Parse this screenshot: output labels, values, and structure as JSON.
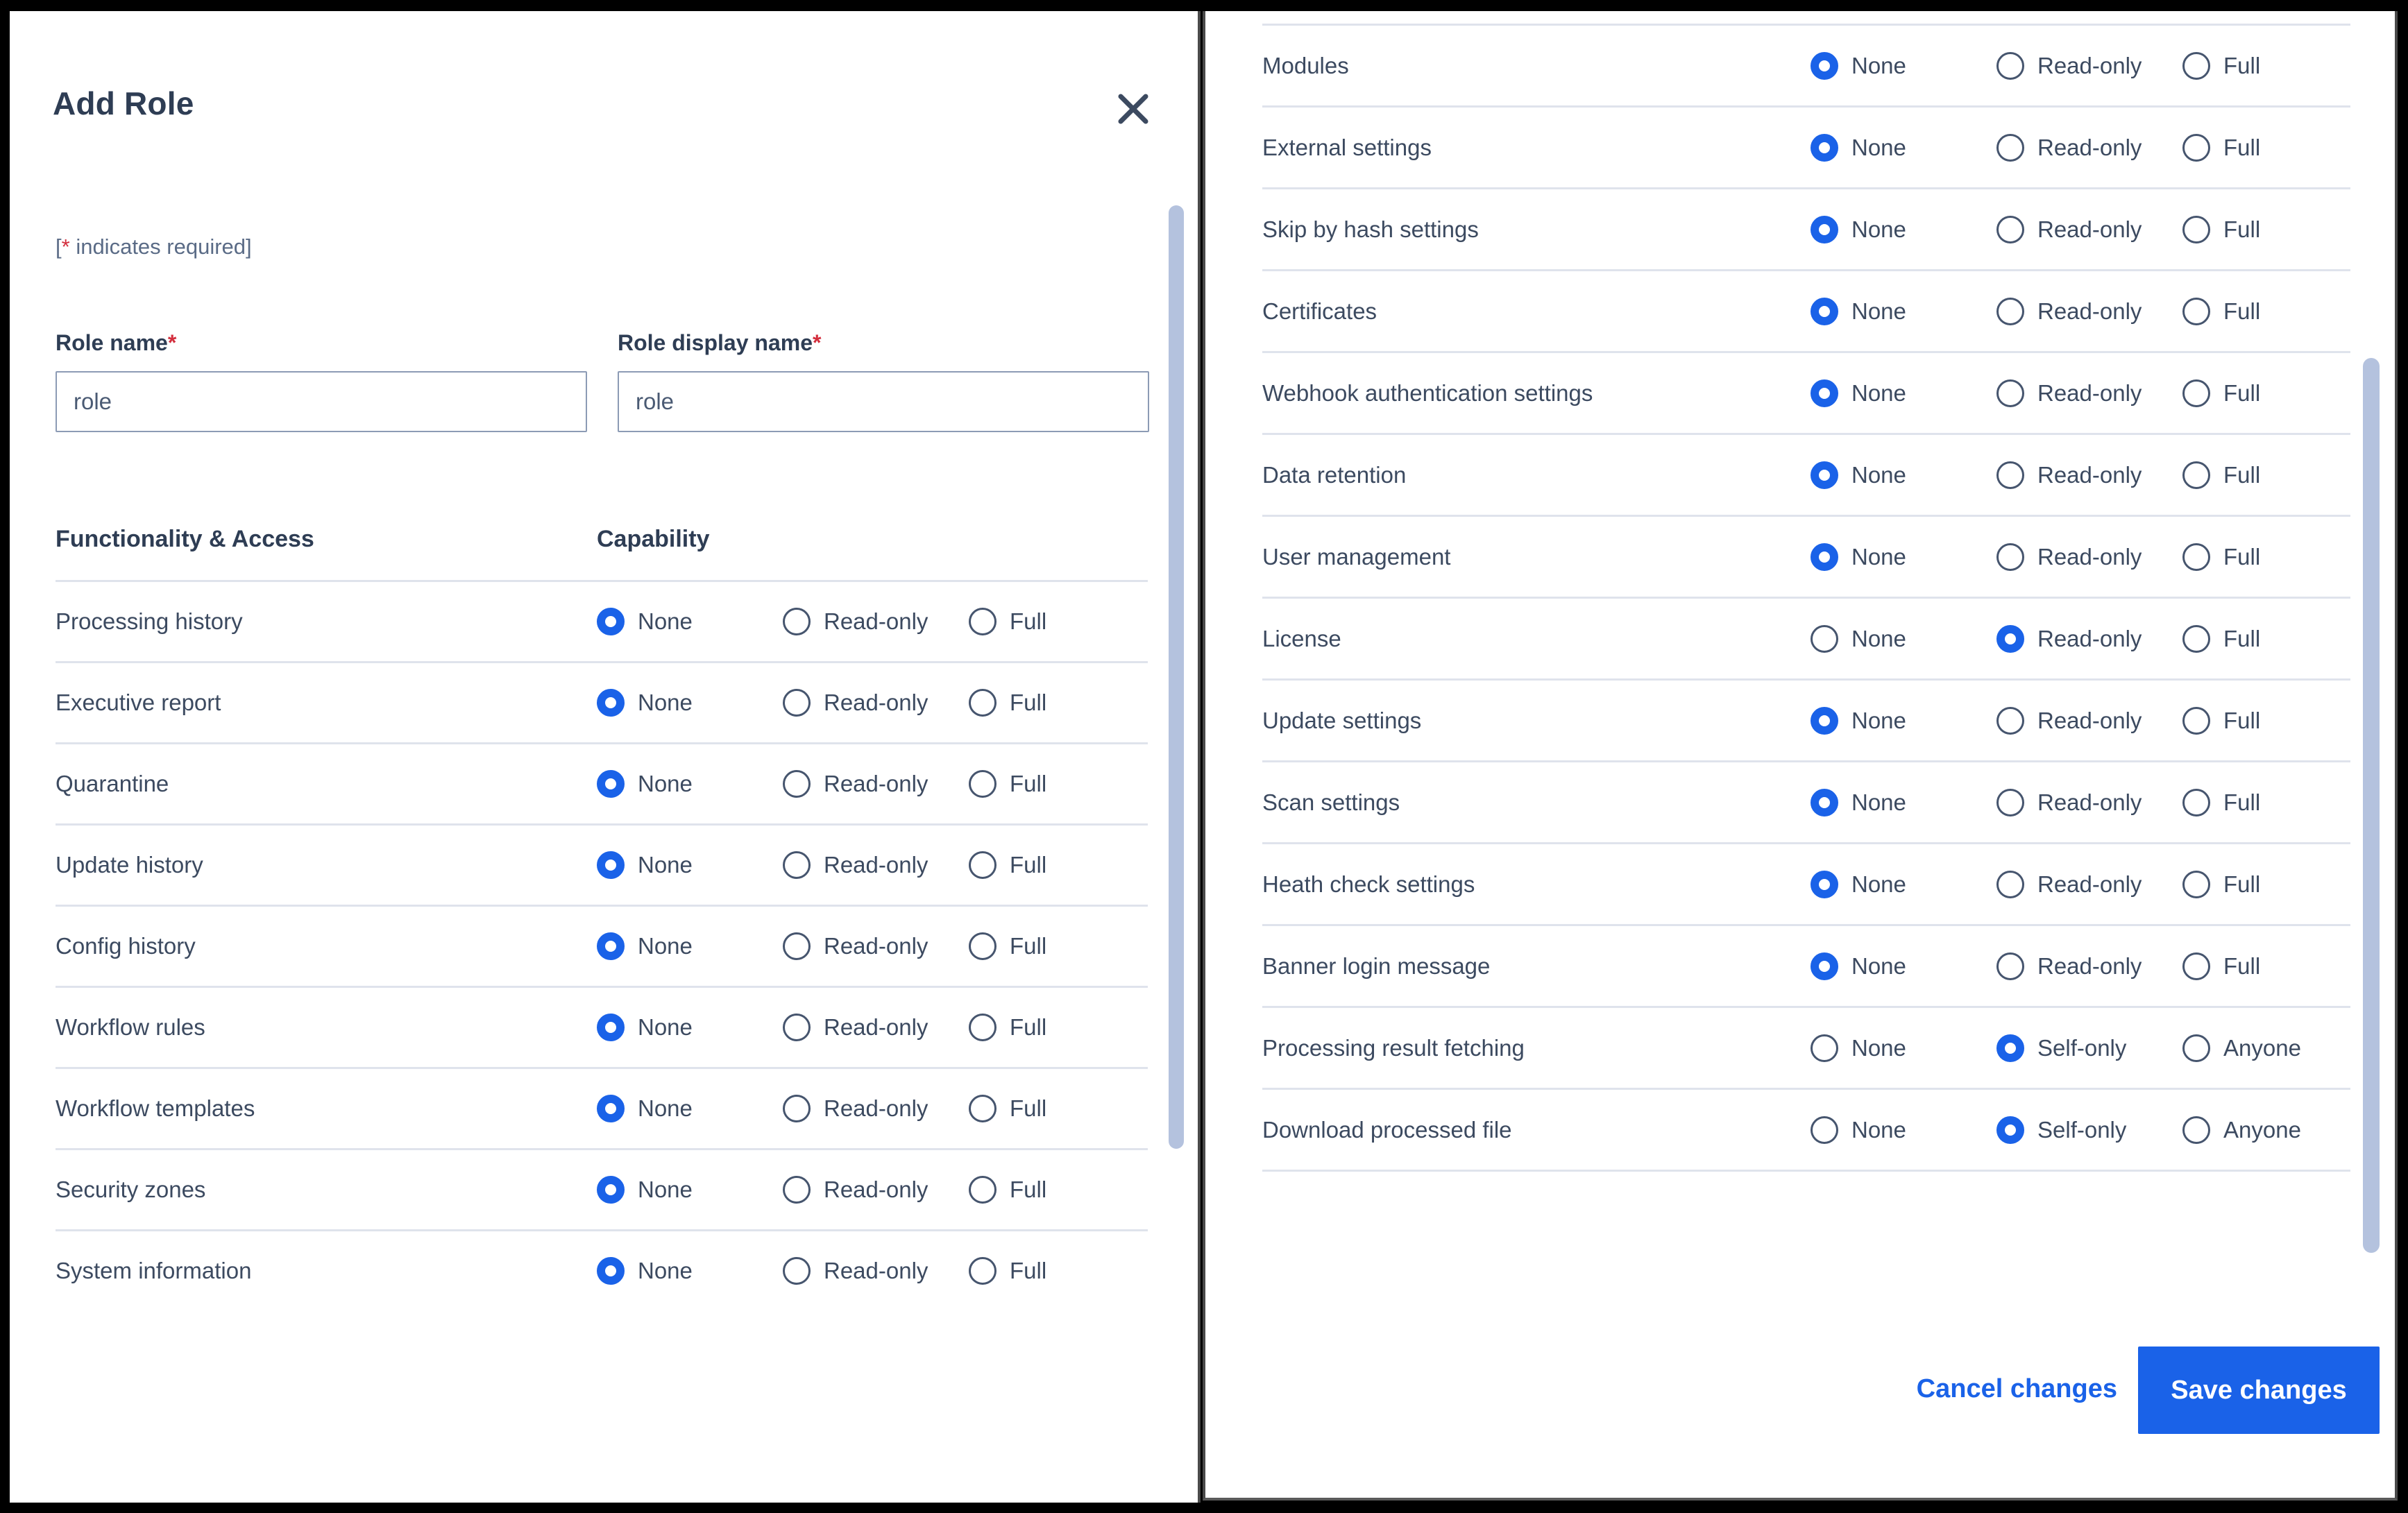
{
  "dialog": {
    "title": "Add Role",
    "close_icon": "close-icon",
    "required_note_prefix": "[",
    "required_note_star": "*",
    "required_note_text": " indicates required]",
    "accent_color": "#1a62e8",
    "required_star_color": "#d32e3d",
    "text_color": "#3c4a60",
    "heading_color": "#2e3d54"
  },
  "fields": {
    "role_name": {
      "label": "Role name",
      "required_mark": "*",
      "value": "role",
      "placeholder": "role"
    },
    "role_display_name": {
      "label": "Role display name",
      "required_mark": "*",
      "value": "role",
      "placeholder": "role"
    }
  },
  "table_headers": {
    "functionality": "Functionality & Access",
    "capability": "Capability"
  },
  "option_sets": {
    "access": [
      "None",
      "Read-only",
      "Full"
    ],
    "visibility": [
      "None",
      "Self-only",
      "Anyone"
    ]
  },
  "left_rows": [
    {
      "label": "Processing history",
      "options": [
        "None",
        "Read-only",
        "Full"
      ],
      "selected": 0
    },
    {
      "label": "Executive report",
      "options": [
        "None",
        "Read-only",
        "Full"
      ],
      "selected": 0
    },
    {
      "label": "Quarantine",
      "options": [
        "None",
        "Read-only",
        "Full"
      ],
      "selected": 0
    },
    {
      "label": "Update history",
      "options": [
        "None",
        "Read-only",
        "Full"
      ],
      "selected": 0
    },
    {
      "label": "Config history",
      "options": [
        "None",
        "Read-only",
        "Full"
      ],
      "selected": 0
    },
    {
      "label": "Workflow rules",
      "options": [
        "None",
        "Read-only",
        "Full"
      ],
      "selected": 0
    },
    {
      "label": "Workflow templates",
      "options": [
        "None",
        "Read-only",
        "Full"
      ],
      "selected": 0
    },
    {
      "label": "Security zones",
      "options": [
        "None",
        "Read-only",
        "Full"
      ],
      "selected": 0
    },
    {
      "label": "System information",
      "options": [
        "None",
        "Read-only",
        "Full"
      ],
      "selected": 0
    }
  ],
  "right_rows": [
    {
      "label": "Modules",
      "options": [
        "None",
        "Read-only",
        "Full"
      ],
      "selected": 0
    },
    {
      "label": "External settings",
      "options": [
        "None",
        "Read-only",
        "Full"
      ],
      "selected": 0
    },
    {
      "label": "Skip by hash settings",
      "options": [
        "None",
        "Read-only",
        "Full"
      ],
      "selected": 0
    },
    {
      "label": "Certificates",
      "options": [
        "None",
        "Read-only",
        "Full"
      ],
      "selected": 0
    },
    {
      "label": "Webhook authentication settings",
      "options": [
        "None",
        "Read-only",
        "Full"
      ],
      "selected": 0
    },
    {
      "label": "Data retention",
      "options": [
        "None",
        "Read-only",
        "Full"
      ],
      "selected": 0
    },
    {
      "label": "User management",
      "options": [
        "None",
        "Read-only",
        "Full"
      ],
      "selected": 0
    },
    {
      "label": "License",
      "options": [
        "None",
        "Read-only",
        "Full"
      ],
      "selected": 1
    },
    {
      "label": "Update settings",
      "options": [
        "None",
        "Read-only",
        "Full"
      ],
      "selected": 0
    },
    {
      "label": "Scan settings",
      "options": [
        "None",
        "Read-only",
        "Full"
      ],
      "selected": 0
    },
    {
      "label": "Heath check settings",
      "options": [
        "None",
        "Read-only",
        "Full"
      ],
      "selected": 0
    },
    {
      "label": "Banner login message",
      "options": [
        "None",
        "Read-only",
        "Full"
      ],
      "selected": 0
    },
    {
      "label": "Processing result fetching",
      "options": [
        "None",
        "Self-only",
        "Anyone"
      ],
      "selected": 1
    },
    {
      "label": "Download processed file",
      "options": [
        "None",
        "Self-only",
        "Anyone"
      ],
      "selected": 1
    }
  ],
  "footer": {
    "cancel_label": "Cancel changes",
    "save_label": "Save changes"
  },
  "scrollbars": {
    "left_thumb": "left-scrollbar-thumb",
    "right_thumb": "right-scrollbar-thumb"
  }
}
